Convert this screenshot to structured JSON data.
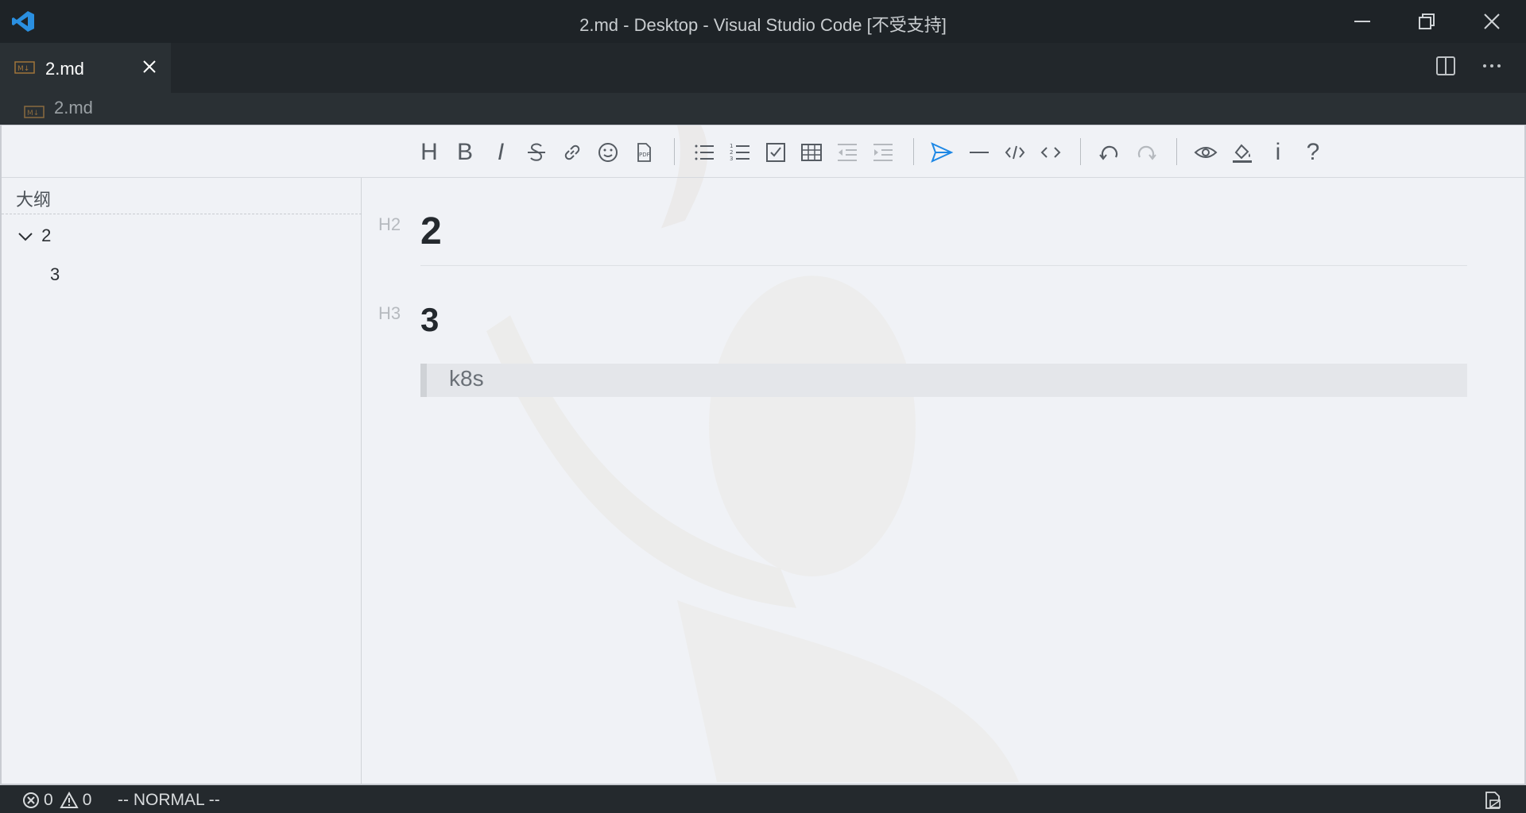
{
  "window": {
    "title": "2.md - Desktop - Visual Studio Code [不受支持]"
  },
  "tabs": [
    {
      "label": "2.md",
      "active": true
    }
  ],
  "breadcrumb": {
    "label": "2.md"
  },
  "toolbar": {
    "items": [
      "heading",
      "bold",
      "italic",
      "strike",
      "link",
      "emoji",
      "export-pdf",
      "list",
      "ordered-list",
      "check",
      "table",
      "outdent",
      "indent",
      "send",
      "line",
      "inline-code",
      "code-block",
      "undo",
      "redo",
      "preview",
      "fill",
      "info",
      "help"
    ],
    "glyphs": {
      "heading": "H",
      "bold": "B",
      "italic": "I",
      "info": "i",
      "help": "?"
    }
  },
  "sidebar": {
    "title": "大纲",
    "items": [
      {
        "label": "2",
        "level": 2
      },
      {
        "label": "3",
        "level": 3
      }
    ]
  },
  "content": {
    "h2_marker": "H2",
    "h2_text": "2",
    "h3_marker": "H3",
    "h3_text": "3",
    "quote_text": "k8s"
  },
  "status": {
    "errors": "0",
    "warnings": "0",
    "mode": "-- NORMAL --"
  },
  "colors": {
    "accent": "#1e88e5",
    "titlebar": "#1e2327",
    "editor_bg": "#f0f2f6"
  }
}
